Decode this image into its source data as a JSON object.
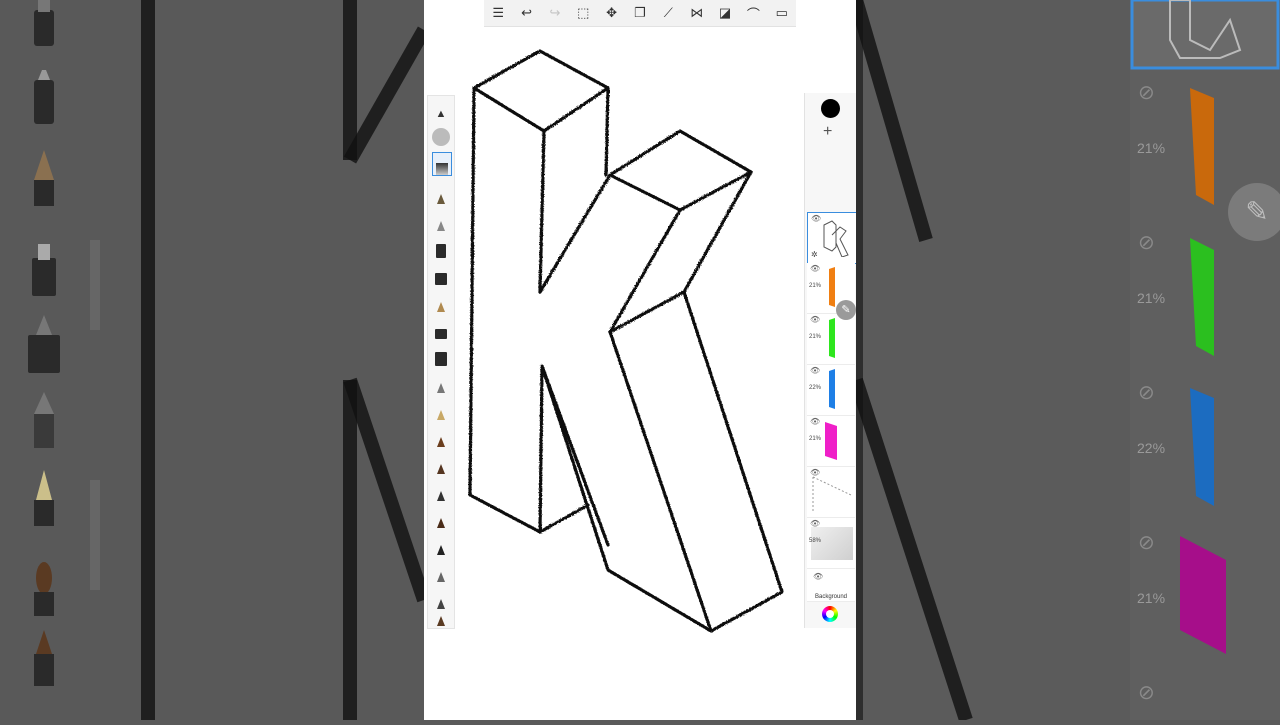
{
  "toolbar": {
    "icons": [
      "list-icon",
      "undo-icon",
      "redo-icon",
      "selection-icon",
      "transform-icon",
      "layers-icon",
      "ruler-icon",
      "symmetry-icon",
      "shapes-icon",
      "curve-icon",
      "fullscreen-icon"
    ]
  },
  "layers": [
    {
      "name": "layer-sketch",
      "opacity": "",
      "color": "#000000",
      "selected": true
    },
    {
      "name": "layer-orange",
      "opacity": "21%",
      "color": "#f07f12",
      "selected": false
    },
    {
      "name": "layer-green",
      "opacity": "21%",
      "color": "#2ee61e",
      "selected": false
    },
    {
      "name": "layer-blue",
      "opacity": "22%",
      "color": "#1e7fe6",
      "selected": false
    },
    {
      "name": "layer-magenta",
      "opacity": "21%",
      "color": "#ef1fc8",
      "selected": false
    },
    {
      "name": "layer-guides",
      "opacity": "",
      "color": "#999999",
      "selected": false
    },
    {
      "name": "layer-paper",
      "opacity": "58%",
      "color": "#dddddd",
      "selected": false
    },
    {
      "name": "layer-background",
      "opacity": "",
      "color": "#ffffff",
      "selected": false,
      "label": "Background"
    }
  ],
  "backdrop": {
    "pcts": [
      "21%",
      "21%",
      "22%",
      "21%"
    ]
  },
  "colors": {
    "accent": "#3a8dde",
    "current_color": "#000000"
  }
}
